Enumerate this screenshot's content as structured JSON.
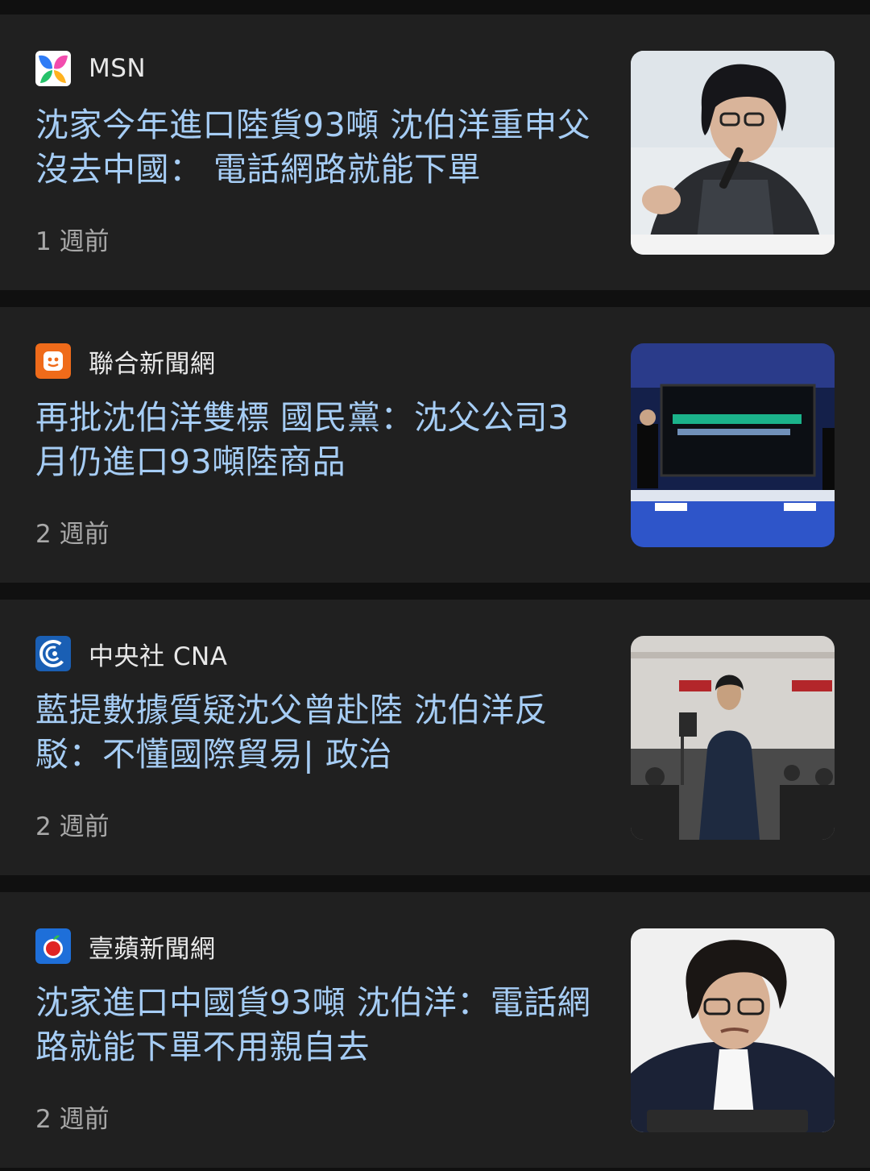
{
  "articles": [
    {
      "source": "MSN",
      "logo_icon": "msn-butterfly-icon",
      "headline": "沈家今年進口陸貨93噸 沈伯洋重申父沒去中國： 電話網路就能下單",
      "age": "1 週前",
      "image_desc_icon": "man-with-microphone-photo"
    },
    {
      "source": "聯合新聞網",
      "logo_icon": "udn-logo-icon",
      "headline": "再批沈伯洋雙標 國民黨：沈父公司3月仍進口93噸陸商品",
      "age": "2 週前",
      "image_desc_icon": "press-conference-photo"
    },
    {
      "source": "中央社 CNA",
      "logo_icon": "cna-logo-icon",
      "headline": "藍提數據質疑沈父曾赴陸 沈伯洋反駁：不懂國際貿易| 政治",
      "age": "2 週前",
      "image_desc_icon": "legislature-hall-photo"
    },
    {
      "source": "壹蘋新聞網",
      "logo_icon": "nextapple-logo-icon",
      "headline": "沈家進口中國貨93噸 沈伯洋：電話網路就能下單不用親自去",
      "age": "2 週前",
      "image_desc_icon": "man-portrait-photo"
    }
  ],
  "colors": {
    "background": "#101010",
    "card": "#202020",
    "headline": "#a6cdf5",
    "source": "#e8e8e8",
    "age": "#a9a9a9"
  }
}
